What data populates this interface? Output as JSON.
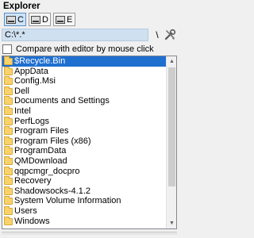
{
  "panel": {
    "title": "Explorer"
  },
  "drives": [
    {
      "label": "C",
      "active": true
    },
    {
      "label": "D",
      "active": false
    },
    {
      "label": "E",
      "active": false
    }
  ],
  "path_bar": {
    "value": "C:\\*.*",
    "slash_label": "\\"
  },
  "options": {
    "compare_label": "Compare with editor by mouse click",
    "compare_checked": false
  },
  "folders": [
    "$Recycle.Bin",
    "AppData",
    "Config.Msi",
    "Dell",
    "Documents and Settings",
    "Intel",
    "PerfLogs",
    "Program Files",
    "Program Files (x86)",
    "ProgramData",
    "QMDownload",
    "qqpcmgr_docpro",
    "Recovery",
    "Shadowsocks-4.1.2",
    "System Volume Information",
    "Users",
    "Windows"
  ],
  "selected_index": 0,
  "icons": {
    "drive": "drive-icon",
    "folder": "folder-icon",
    "tools": "tools-icon",
    "scroll_up": "arrow-up-icon",
    "scroll_down": "arrow-down-icon"
  },
  "colors": {
    "selection": "#1f6fcf",
    "path_bar": "#cfe0f1",
    "folder": "#f8d26a"
  }
}
